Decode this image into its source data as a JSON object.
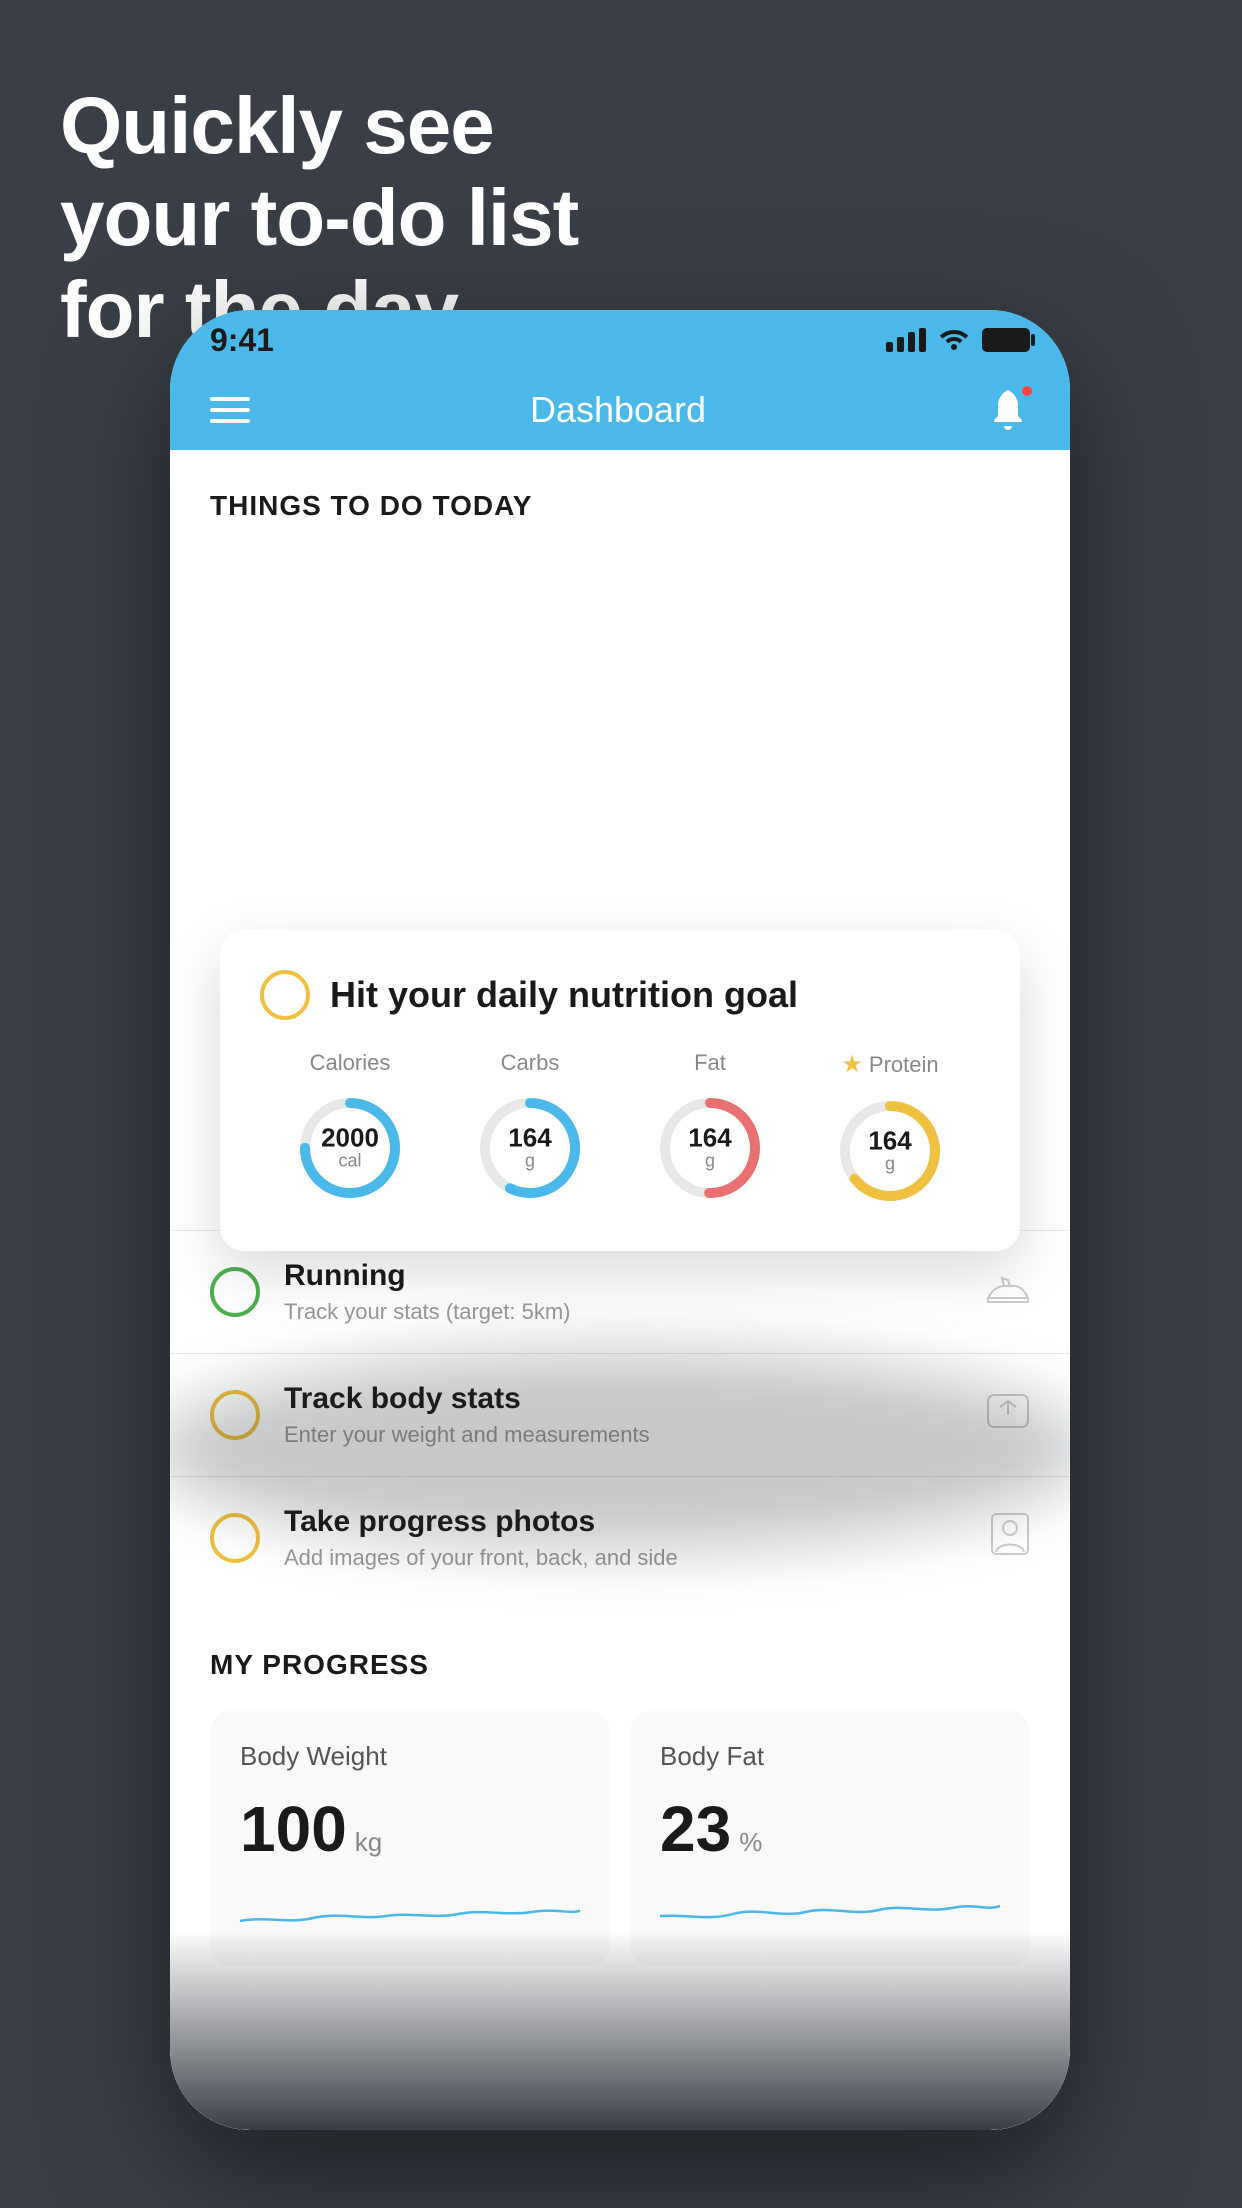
{
  "headline": {
    "line1": "Quickly see",
    "line2": "your to-do list",
    "line3": "for the day."
  },
  "phone": {
    "status_bar": {
      "time": "9:41"
    },
    "header": {
      "title": "Dashboard"
    },
    "things_today": {
      "label": "THINGS TO DO TODAY"
    },
    "floating_card": {
      "title": "Hit your daily nutrition goal",
      "nutrition": [
        {
          "label": "Calories",
          "value": "2000",
          "unit": "cal",
          "color": "blue",
          "star": false
        },
        {
          "label": "Carbs",
          "value": "164",
          "unit": "g",
          "color": "blue",
          "star": false
        },
        {
          "label": "Fat",
          "value": "164",
          "unit": "g",
          "color": "pink",
          "star": false
        },
        {
          "label": "Protein",
          "value": "164",
          "unit": "g",
          "color": "gold",
          "star": true
        }
      ]
    },
    "todo_items": [
      {
        "title": "Running",
        "subtitle": "Track your stats (target: 5km)",
        "circle": "green",
        "icon": "shoe"
      },
      {
        "title": "Track body stats",
        "subtitle": "Enter your weight and measurements",
        "circle": "yellow",
        "icon": "scale"
      },
      {
        "title": "Take progress photos",
        "subtitle": "Add images of your front, back, and side",
        "circle": "yellow",
        "icon": "portrait"
      }
    ],
    "my_progress": {
      "label": "MY PROGRESS",
      "cards": [
        {
          "title": "Body Weight",
          "value": "100",
          "unit": "kg"
        },
        {
          "title": "Body Fat",
          "value": "23",
          "unit": "%"
        }
      ]
    }
  }
}
